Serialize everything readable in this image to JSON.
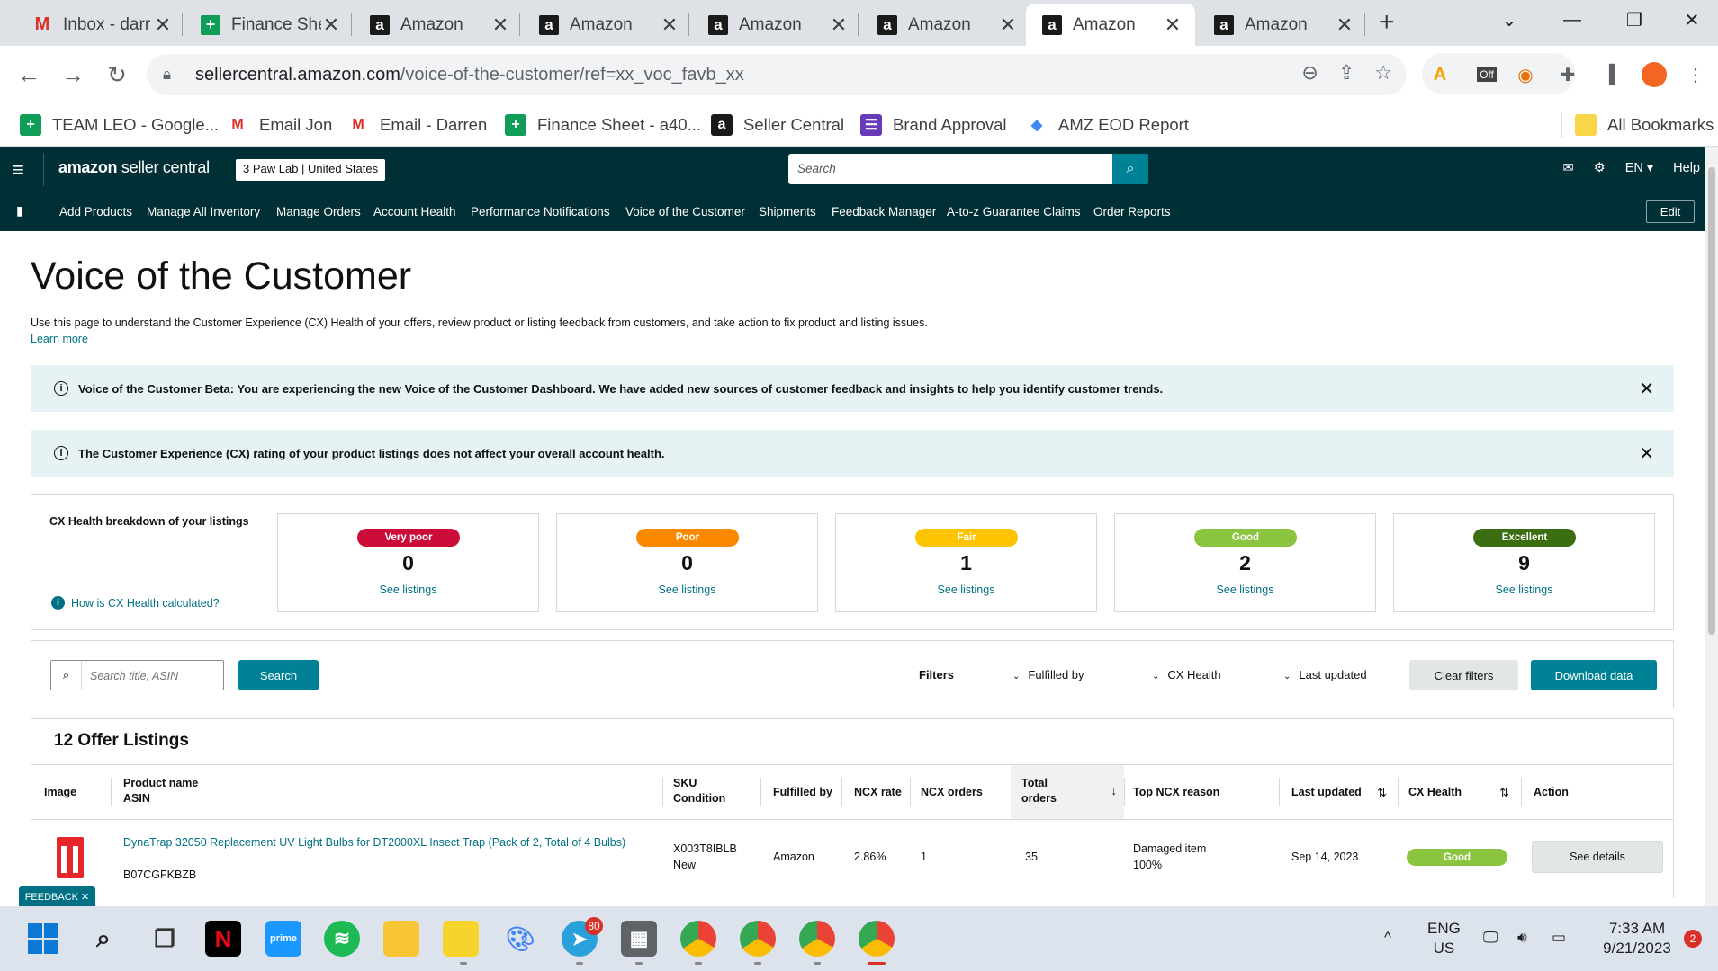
{
  "browser": {
    "tabs": [
      {
        "title": "Inbox - darr",
        "icon": "gmail-icon"
      },
      {
        "title": "Finance She",
        "icon": "sheets-icon"
      },
      {
        "title": "Amazon",
        "icon": "amazon-icon"
      },
      {
        "title": "Amazon",
        "icon": "amazon-icon"
      },
      {
        "title": "Amazon",
        "icon": "amazon-icon"
      },
      {
        "title": "Amazon",
        "icon": "amazon-icon"
      },
      {
        "title": "Amazon",
        "icon": "amazon-icon",
        "active": true
      },
      {
        "title": "Amazon",
        "icon": "amazon-icon"
      }
    ],
    "url_host": "sellercentral.amazon.com",
    "url_path": "/voice-of-the-customer/ref=xx_voc_favb_xx",
    "extension_off_label": "Off",
    "bookmarks": [
      {
        "label": "TEAM LEO - Google...",
        "icon": "sheets-icon"
      },
      {
        "label": "Email Jon",
        "icon": "gmail-icon"
      },
      {
        "label": "Email - Darren",
        "icon": "gmail-icon"
      },
      {
        "label": "Finance Sheet - a40...",
        "icon": "sheets-icon"
      },
      {
        "label": "Seller Central",
        "icon": "amazon-icon"
      },
      {
        "label": "Brand Approval",
        "icon": "forms-icon"
      },
      {
        "label": "AMZ EOD Report",
        "icon": "report-icon"
      }
    ],
    "all_bookmarks": "All Bookmarks"
  },
  "header": {
    "logo_brand": "amazon",
    "logo_product": "seller central",
    "store": "3 Paw Lab",
    "marketplace": "United States",
    "search_placeholder": "Search",
    "language": "EN",
    "help": "Help"
  },
  "nav": {
    "items": [
      "Add Products",
      "Manage All Inventory",
      "Manage Orders",
      "Account Health",
      "Performance Notifications",
      "Voice of the Customer",
      "Shipments",
      "Feedback Manager",
      "A-to-z Guarantee Claims",
      "Order Reports"
    ],
    "edit": "Edit"
  },
  "page": {
    "title": "Voice of the Customer",
    "description": "Use this page to understand the Customer Experience (CX) Health of your offers, review product or listing feedback from customers, and take action to fix product and listing issues.",
    "learn_more": "Learn more",
    "alerts": [
      "Voice of the Customer Beta: You are experiencing the new Voice of the Customer Dashboard. We have added new sources of customer feedback and insights to help you identify customer trends.",
      "The Customer Experience (CX) rating of your product listings does not affect your overall account health."
    ]
  },
  "cx_health": {
    "title": "CX Health breakdown of your listings",
    "how_link": "How is CX Health calculated?",
    "see_listings": "See listings",
    "cards": [
      {
        "label": "Very poor",
        "count": "0",
        "color": "#cc0c39"
      },
      {
        "label": "Poor",
        "count": "0",
        "color": "#fa8900"
      },
      {
        "label": "Fair",
        "count": "1",
        "color": "#ffc400"
      },
      {
        "label": "Good",
        "count": "2",
        "color": "#8bc43f"
      },
      {
        "label": "Excellent",
        "count": "9",
        "color": "#3b6e11"
      }
    ]
  },
  "filters": {
    "search_placeholder": "Search title, ASIN",
    "search_button": "Search",
    "filters_label": "Filters",
    "dropdowns": [
      "Fulfilled by",
      "CX Health",
      "Last updated"
    ],
    "clear": "Clear filters",
    "download": "Download data"
  },
  "listings": {
    "title": "12 Offer Listings",
    "columns": {
      "image": "Image",
      "product_name": "Product name",
      "asin": "ASIN",
      "sku": "SKU",
      "condition": "Condition",
      "fulfilled_by": "Fulfilled by",
      "ncx_rate": "NCX rate",
      "ncx_orders": "NCX orders",
      "total_orders_1": "Total",
      "total_orders_2": "orders",
      "top_reason": "Top NCX reason",
      "last_updated": "Last updated",
      "cx_health": "CX Health",
      "action": "Action"
    },
    "rows": [
      {
        "product_name": "DynaTrap 32050 Replacement UV Light Bulbs for DT2000XL Insect Trap (Pack of 2, Total of 4 Bulbs)",
        "asin": "B07CGFKBZB",
        "sku": "X003T8IBLB",
        "condition": "New",
        "fulfilled_by": "Amazon",
        "ncx_rate": "2.86%",
        "ncx_orders": "1",
        "total_orders": "35",
        "top_reason": "Damaged item",
        "top_reason_pct": "100%",
        "last_updated": "Sep 14, 2023",
        "cx_health": "Good",
        "action": "See details"
      }
    ]
  },
  "feedback_tab": "FEEDBACK ✕",
  "taskbar": {
    "telegram_badge": "80",
    "lang_line1": "ENG",
    "lang_line2": "US",
    "time": "7:33 AM",
    "date": "9/21/2023",
    "notifications": "2"
  }
}
